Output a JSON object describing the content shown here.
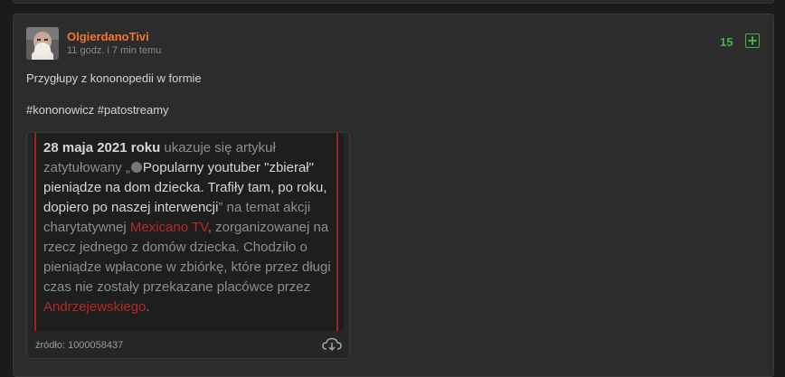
{
  "post": {
    "author": "OlgierdanoTivi",
    "time_ago": "11 godz. i 7 min temu",
    "votes": "15",
    "body": "Przygłupy z kononopedii w formie",
    "tags": [
      "#kononowicz",
      "#patostreamy"
    ],
    "embed": {
      "source_label": "źródło: 1000058437",
      "segments": {
        "s1": "28 maja 2021 roku",
        "s2": " ukazuje się artykuł zatytułowany „",
        "s3": "Popularny youtuber \"zbierał\" pieniądze na dom dziecka. Trafiły tam, po roku, dopiero po naszej interwencji",
        "s4": "” na temat akcji charytatywnej ",
        "s5": "Mexicano TV",
        "s6": ", ",
        "s7": "zorganizowanej na rzecz jednego z domów dziecka. Chodziło o pieniądze wpłacone w zbiórkę, które przez długi czas nie zostały przekazane placówce przez ",
        "s8": "Andrzejewskiego",
        "s9": "."
      }
    }
  },
  "colors": {
    "author": "#f5762e",
    "votes": "#4cae4c",
    "link_red": "#b42a2a"
  },
  "icons": {
    "plus": "plus-icon",
    "download": "cloud-download-icon",
    "globe": "globe-icon"
  }
}
